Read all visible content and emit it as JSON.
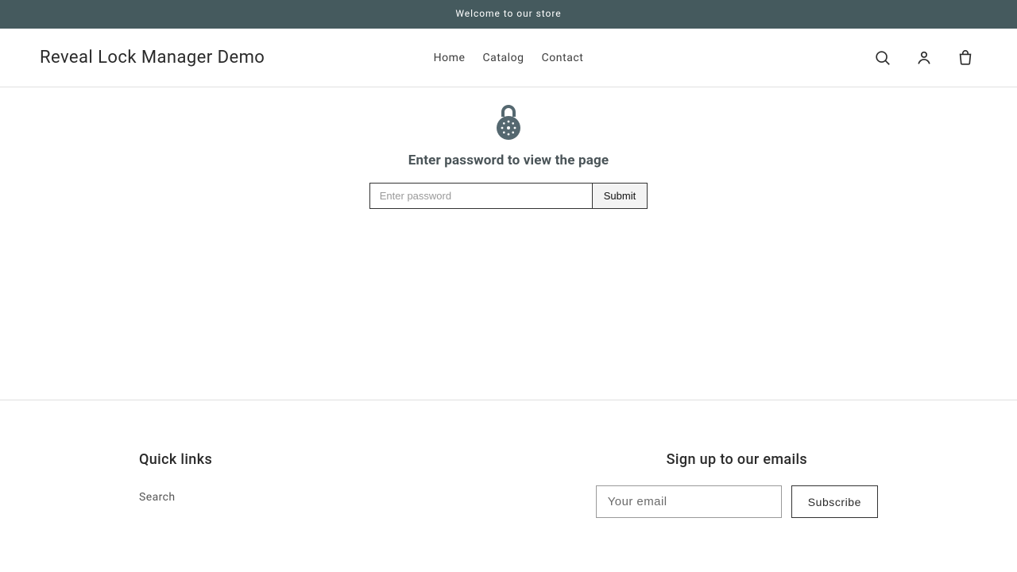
{
  "announcement": {
    "text": "Welcome to our store"
  },
  "header": {
    "brand": "Reveal Lock Manager Demo",
    "nav": [
      {
        "label": "Home"
      },
      {
        "label": "Catalog"
      },
      {
        "label": "Contact"
      }
    ]
  },
  "lock": {
    "title": "Enter password to view the page",
    "placeholder": "Enter password",
    "submit_label": "Submit"
  },
  "footer": {
    "quick_links_title": "Quick links",
    "links": [
      {
        "label": "Search"
      }
    ],
    "signup_title": "Sign up to our emails",
    "email_placeholder": "Your email",
    "subscribe_label": "Subscribe"
  },
  "colors": {
    "announcement_bg": "#455a5e",
    "lock_icon": "#556870"
  }
}
